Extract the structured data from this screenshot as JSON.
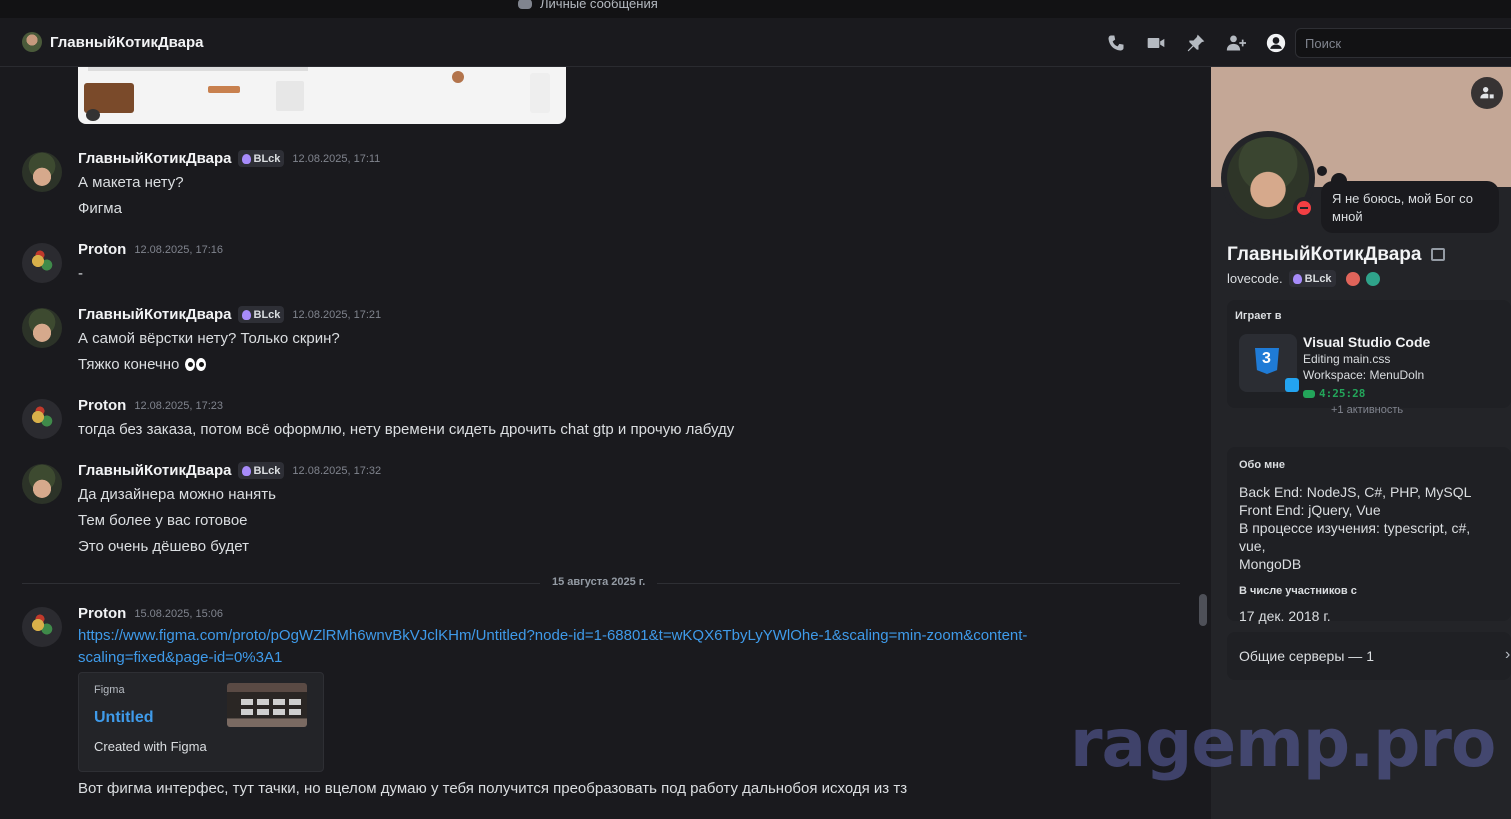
{
  "app": {
    "window_title": "Личные сообщения"
  },
  "header": {
    "title": "ГлавныйКотикДвара",
    "search_placeholder": "Поиск"
  },
  "messages": [
    {
      "author": "ГлавныйКотикДвара",
      "badge": "BLck",
      "time": "12.08.2025, 17:11",
      "lines": [
        "А макета нету?",
        "Фигма"
      ]
    },
    {
      "author": "Proton",
      "time": "12.08.2025, 17:16",
      "lines": [
        "-"
      ]
    },
    {
      "author": "ГлавныйКотикДвара",
      "badge": "BLck",
      "time": "12.08.2025, 17:21",
      "lines": [
        "А самой вёрстки нету? Только скрин?",
        "Тяжко конечно"
      ]
    },
    {
      "author": "Proton",
      "time": "12.08.2025, 17:23",
      "lines": [
        "тогда без заказа, потом  всё оформлю, нету времени сидеть дрочить chat gtp и прочую лабуду"
      ]
    },
    {
      "author": "ГлавныйКотикДвара",
      "badge": "BLck",
      "time": "12.08.2025, 17:32",
      "lines": [
        "Да дизайнера можно нанять",
        "Тем более у вас готовое",
        "Это очень дёшево будет"
      ]
    },
    {
      "author": "Proton",
      "time": "15.08.2025, 15:06",
      "link_line1": "https://www.figma.com/proto/pOgWZlRMh6wnvBkVJclKHm/Untitled?node-id=1-68801&t=wKQX6TbyLyYWlOhe-1&scaling=min-zoom&content-",
      "link_line2": "scaling=fixed&page-id=0%3A1",
      "embed": {
        "provider": "Figma",
        "title": "Untitled",
        "description": "Created with Figma"
      },
      "lines": [
        "Вот фигма интерфес, тут тачки, но вцелом думаю у тебя получится преобразовать под работу дальнобоя исходя из тз"
      ]
    }
  ],
  "date_divider": "15 августа 2025 г.",
  "profile": {
    "status_text": "Я не боюсь, мой Бог со мной",
    "display_name": "ГлавныйКотикДвара",
    "username": "lovecode.",
    "badge": "BLck",
    "activity": {
      "header": "Играет в",
      "app": "Visual Studio Code",
      "details": "Editing main.css",
      "state": "Workspace: MenuDoln",
      "elapsed": "4:25:28",
      "more": "+1 активность"
    },
    "about": {
      "header": "Обо мне",
      "lines": [
        "Back End: NodeJS, C#, PHP, MySQL",
        "Front End: jQuery, Vue",
        "В процессе изучения: typescript, c#, vue,",
        "MongoDB"
      ]
    },
    "member_since": {
      "header": "В числе участников с",
      "value": "17 дек. 2018 г."
    },
    "mutual_servers": "Общие серверы — 1"
  },
  "watermark": "ragemp.pro",
  "colors": {
    "background": "#1a1a1e",
    "panel": "#232428",
    "link": "#3f9bea",
    "dnd": "#f23f43",
    "online_green": "#23a55a"
  }
}
